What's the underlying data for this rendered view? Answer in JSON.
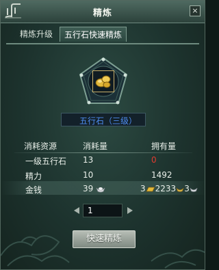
{
  "window": {
    "title": "精炼"
  },
  "close_label": "×",
  "tabs": [
    {
      "label": "精炼升级",
      "active": false
    },
    {
      "label": "五行石快速精炼",
      "active": true
    }
  ],
  "item_slot": {
    "icon": "gold-ore-icon"
  },
  "material_select": {
    "selected": "五行石（三级）"
  },
  "table": {
    "headers": [
      "消耗资源",
      "消耗量",
      "拥有量"
    ],
    "rows": [
      {
        "resource": "一级五行石",
        "cost": "13",
        "owned": "0",
        "owned_color": "#e23b2f"
      },
      {
        "resource": "精力",
        "cost": "10",
        "owned": "1492"
      },
      {
        "resource": "金钱",
        "cost": "39",
        "owned_gold": "3",
        "owned_silver": "2233",
        "owned_copper": "3"
      }
    ]
  },
  "quantity": {
    "value": "1"
  },
  "action": {
    "label": "快速精炼"
  },
  "colors": {
    "accent": "#4e8cf0",
    "warning": "#e23b2f",
    "gold": "#e3b93a"
  }
}
